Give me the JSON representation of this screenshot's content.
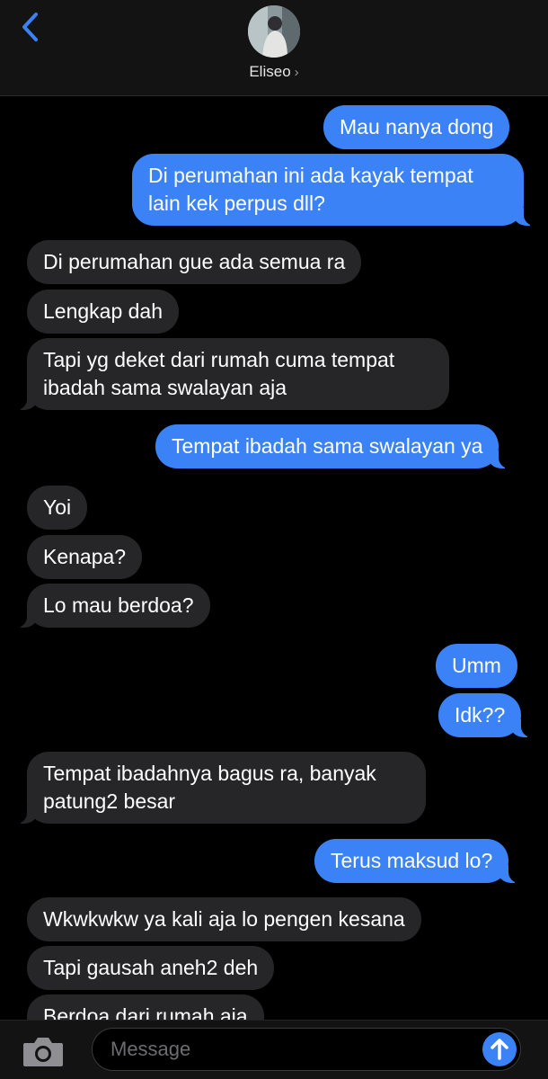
{
  "header": {
    "contact_name": "Eliseo",
    "contact_chevron": "›"
  },
  "messages": [
    {
      "from": "me",
      "text": "Mau nanya dong"
    },
    {
      "from": "me",
      "text": "Di perumahan ini ada kayak tempat lain kek perpus dll?"
    },
    {
      "from": "them",
      "text": "Di perumahan gue ada semua ra"
    },
    {
      "from": "them",
      "text": "Lengkap dah"
    },
    {
      "from": "them",
      "text": "Tapi yg deket dari rumah cuma tempat ibadah sama swalayan aja"
    },
    {
      "from": "me",
      "text": "Tempat ibadah sama swalayan ya"
    },
    {
      "from": "them",
      "text": "Yoi"
    },
    {
      "from": "them",
      "text": "Kenapa?"
    },
    {
      "from": "them",
      "text": "Lo mau berdoa?"
    },
    {
      "from": "me",
      "text": "Umm"
    },
    {
      "from": "me",
      "text": "Idk??"
    },
    {
      "from": "them",
      "text": "Tempat ibadahnya bagus ra, banyak patung2 besar"
    },
    {
      "from": "me",
      "text": "Terus maksud lo?"
    },
    {
      "from": "them",
      "text": "Wkwkwkw ya kali aja lo pengen kesana"
    },
    {
      "from": "them",
      "text": "Tapi gausah aneh2 deh"
    },
    {
      "from": "them",
      "text": "Berdoa dari rumah aja"
    }
  ],
  "composer": {
    "placeholder": "Message"
  },
  "icons": {
    "back": "chevron-left-icon",
    "camera": "camera-icon",
    "send": "arrow-up-icon"
  },
  "colors": {
    "outgoing": "#3b82f6",
    "incoming": "#262629",
    "background": "#000000",
    "accent": "#3b82f6"
  }
}
